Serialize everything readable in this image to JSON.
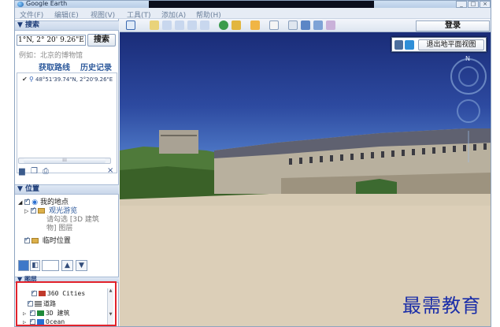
{
  "window": {
    "title": "Google Earth",
    "controls": [
      "_",
      "□",
      "×"
    ]
  },
  "menu": [
    "文件(F)",
    "编辑(E)",
    "视图(V)",
    "工具(T)",
    "添加(A)",
    "帮助(H)"
  ],
  "search": {
    "header": "▼ 搜索",
    "input_value": "1°N, 2° 20' 9.26\"E",
    "button": "搜索",
    "example": "例如：北京的博物馆",
    "links": [
      "获取路线",
      "历史记录"
    ],
    "result": "48°51'39.74\"N, 2°20'9.26\"E",
    "close": "×"
  },
  "places": {
    "header": "▼ 位置",
    "items": [
      {
        "label": "我的地点",
        "checked": true
      },
      {
        "label": "观光游览",
        "checked": true
      },
      {
        "label": "请勾选 [3D 建筑",
        "checked": false
      },
      {
        "label": "物] 图层",
        "checked": false
      },
      {
        "label": "临时位置",
        "checked": true
      }
    ],
    "tool_buttons": [
      "▲",
      "▼"
    ]
  },
  "layers": {
    "header": "▼ 图层",
    "items": [
      {
        "label": "360 Cities",
        "checked": true,
        "color": "#c0392b"
      },
      {
        "label": "道路",
        "checked": true,
        "color": "#666666"
      },
      {
        "label": "3D 建筑",
        "checked": true,
        "color": "#1f8a3a"
      },
      {
        "label": "Ocean",
        "checked": true,
        "color": "#2a6fd1"
      }
    ]
  },
  "toolbar": {
    "login": "登录",
    "icons": [
      "sidebar-toggle-icon",
      "placemark-icon",
      "polygon-icon",
      "path-icon",
      "overlay-icon",
      "tour-icon",
      "sun-icon",
      "planets-icon",
      "ruler-icon",
      "email-icon",
      "print-icon",
      "google-maps-icon"
    ]
  },
  "view": {
    "exit_ground_view": "退出地平面视图",
    "compass_north": "N"
  },
  "watermark": "最需教育",
  "colors": {
    "accent": "#2e5a9c",
    "highlight": "#e2222b",
    "watermark": "#1b2ea8"
  }
}
